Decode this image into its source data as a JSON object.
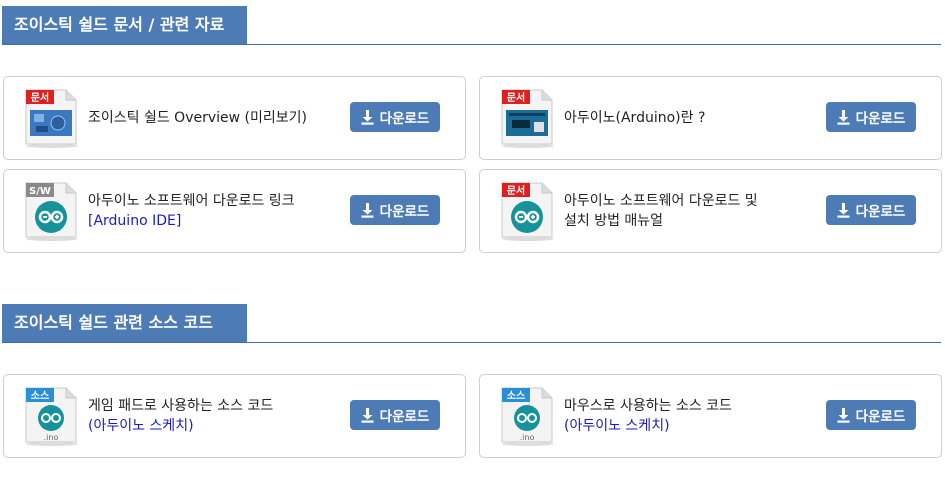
{
  "sections": [
    {
      "title": "조이스틱 쉴드 문서 / 관련 자료",
      "cards": [
        {
          "badge": "문서",
          "line1": "조이스틱 쉴드 Overview (미리보기)",
          "line2": "",
          "button": "다운로드"
        },
        {
          "badge": "문서",
          "line1": "아두이노(Arduino)란 ?",
          "line2": "",
          "button": "다운로드"
        },
        {
          "badge": "S/W",
          "line1": "아두이노 소프트웨어 다운로드 링크",
          "line2": "[Arduino IDE]",
          "button": "다운로드"
        },
        {
          "badge": "문서",
          "line1": "아두이노 소프트웨어 다운로드 및",
          "line2": "설치 방법 매뉴얼",
          "button": "다운로드"
        }
      ]
    },
    {
      "title": "조이스틱 쉴드 관련 소스 코드",
      "cards": [
        {
          "badge": "소스",
          "line1": "게임 패드로 사용하는 소스 코드",
          "line2": "(아두이노 스케치)",
          "button": "다운로드",
          "ext": ".ino"
        },
        {
          "badge": "소스",
          "line1": "마우스로 사용하는 소스 코드",
          "line2": "(아두이노 스케치)",
          "button": "다운로드",
          "ext": ".ino"
        }
      ]
    }
  ],
  "colors": {
    "accent": "#4d7bb5",
    "doc_badge": "#e02020",
    "sw_badge": "#8a8a8a",
    "src_badge": "#2b8fd6",
    "arduino": "#16939a",
    "link": "#1a1acc"
  }
}
